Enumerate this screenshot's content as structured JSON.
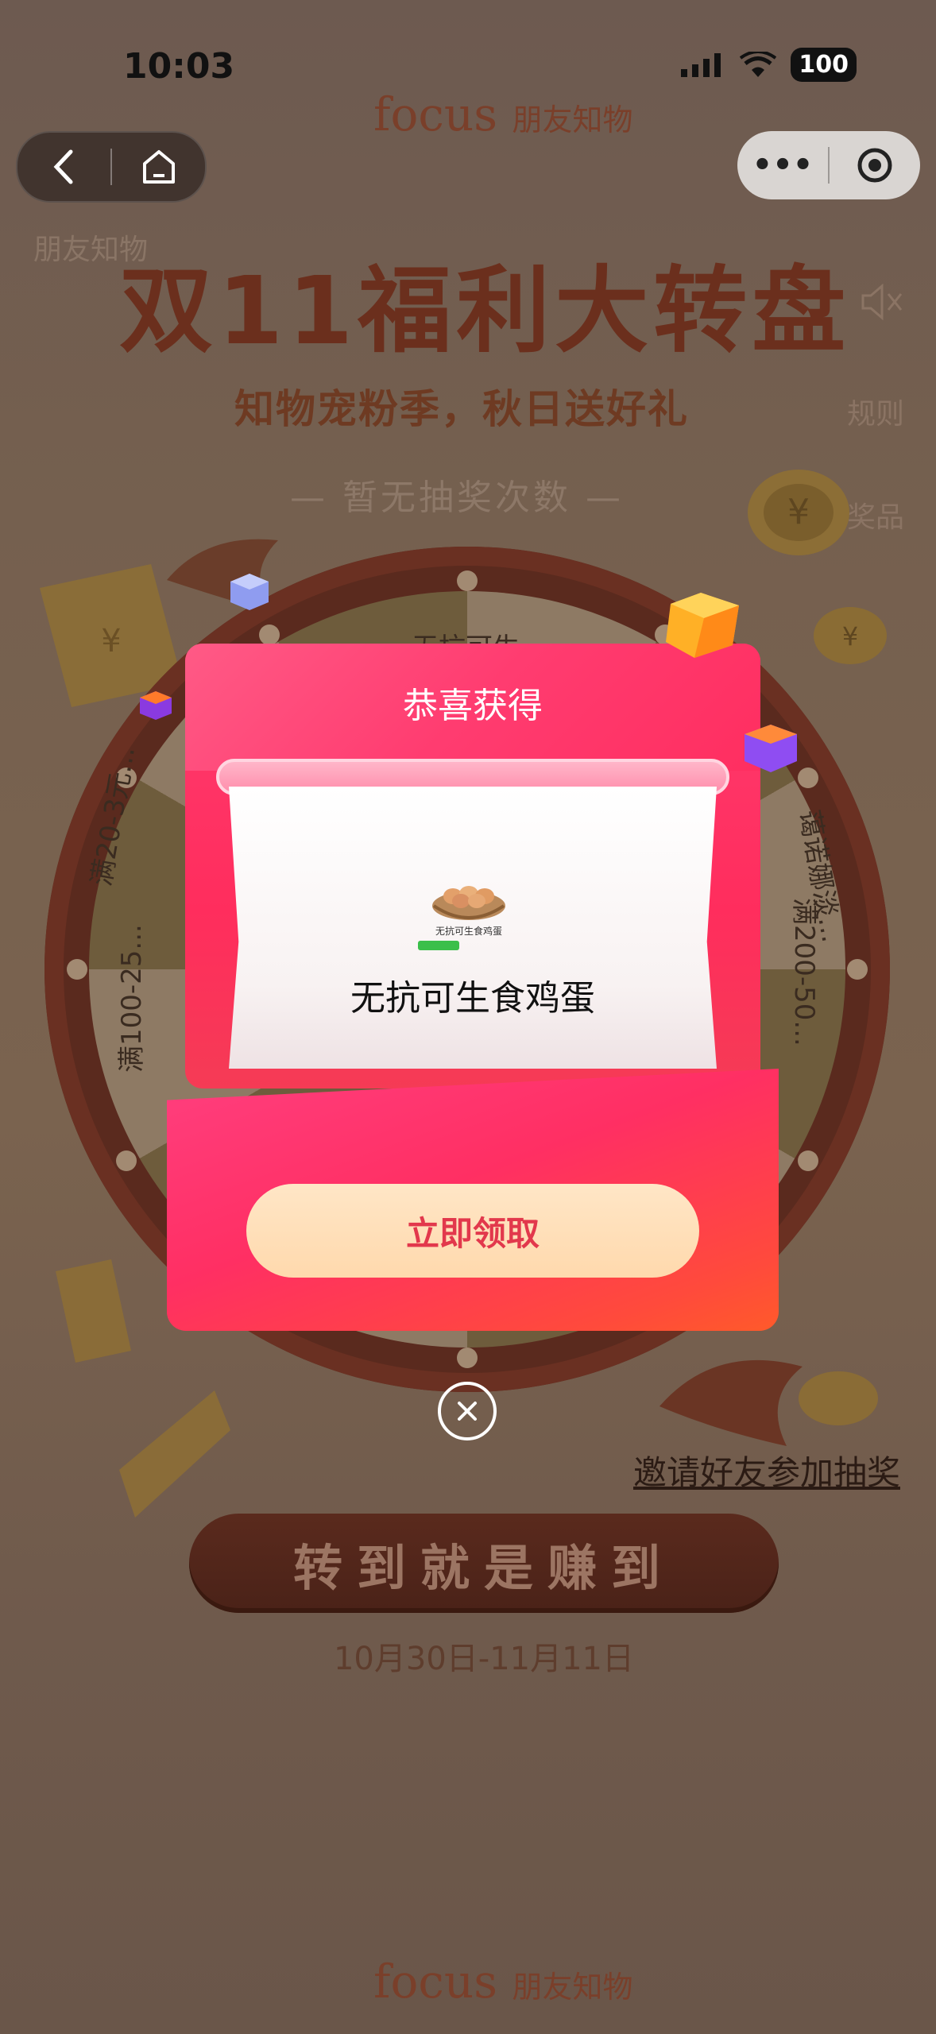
{
  "status_bar": {
    "time": "10:03",
    "battery": "100"
  },
  "nav": {
    "back_icon": "chevron-left-icon",
    "home_icon": "home-icon",
    "more_label": "•••",
    "target_icon": "target-icon"
  },
  "brand": {
    "logo_text": "focus",
    "name": "朋友知物"
  },
  "watermark": "朋友知物",
  "header": {
    "title": "双11福利大转盘",
    "subtitle": "知物宠粉季，秋日送好礼",
    "chances": "— 暂无抽奖次数 —"
  },
  "side_links": {
    "rules": "规则",
    "prizes": "奖品"
  },
  "wheel": {
    "labels": [
      "无抗可生",
      "满20-3元...",
      "满100-25...",
      "满200-50...",
      "蔼诺娜淡..."
    ]
  },
  "popup": {
    "title": "恭喜获得",
    "thumb_caption": "无抗可生食鸡蛋",
    "prize_name": "无抗可生食鸡蛋",
    "claim_label": "立即领取",
    "close_icon": "close-circle-icon"
  },
  "footer": {
    "invite_label": "邀请好友参加抽奖",
    "spin_label": "转到就是赚到",
    "dates": "10月30日-11月11日"
  },
  "colors": {
    "accent": "#ff2d5d",
    "claim_text": "#e2384c",
    "claim_bg": "#ffe0bb"
  }
}
